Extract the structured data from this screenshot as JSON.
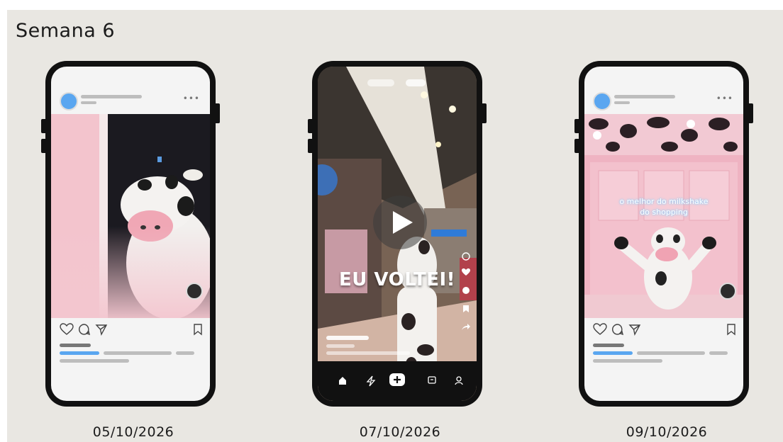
{
  "page": {
    "title": "Semana 6"
  },
  "posts": [
    {
      "date": "05/10/2026",
      "format": "feed-post"
    },
    {
      "date": "07/10/2026",
      "format": "reel",
      "overlay_text": "EU VOLTEI!"
    },
    {
      "date": "09/10/2026",
      "format": "feed-post",
      "sign_line1": "o melhor do milkshake",
      "sign_line2": "do shopping"
    }
  ],
  "colors": {
    "board": "#e9e7e2",
    "phone_frame": "#111111",
    "accent_blue": "#5aa6f0",
    "placeholder_grey": "#bdbdbd",
    "brand_pink": "#f1b8c4"
  },
  "icons": {
    "post_actions": [
      "heart-icon",
      "comment-icon",
      "share-icon",
      "bookmark-icon"
    ],
    "reel_nav": [
      "home-icon",
      "reels-icon",
      "create-icon",
      "messages-icon",
      "profile-icon"
    ],
    "reel_side": [
      "camera-icon",
      "heart-icon",
      "comment-icon",
      "bookmark-icon",
      "share-icon"
    ]
  }
}
